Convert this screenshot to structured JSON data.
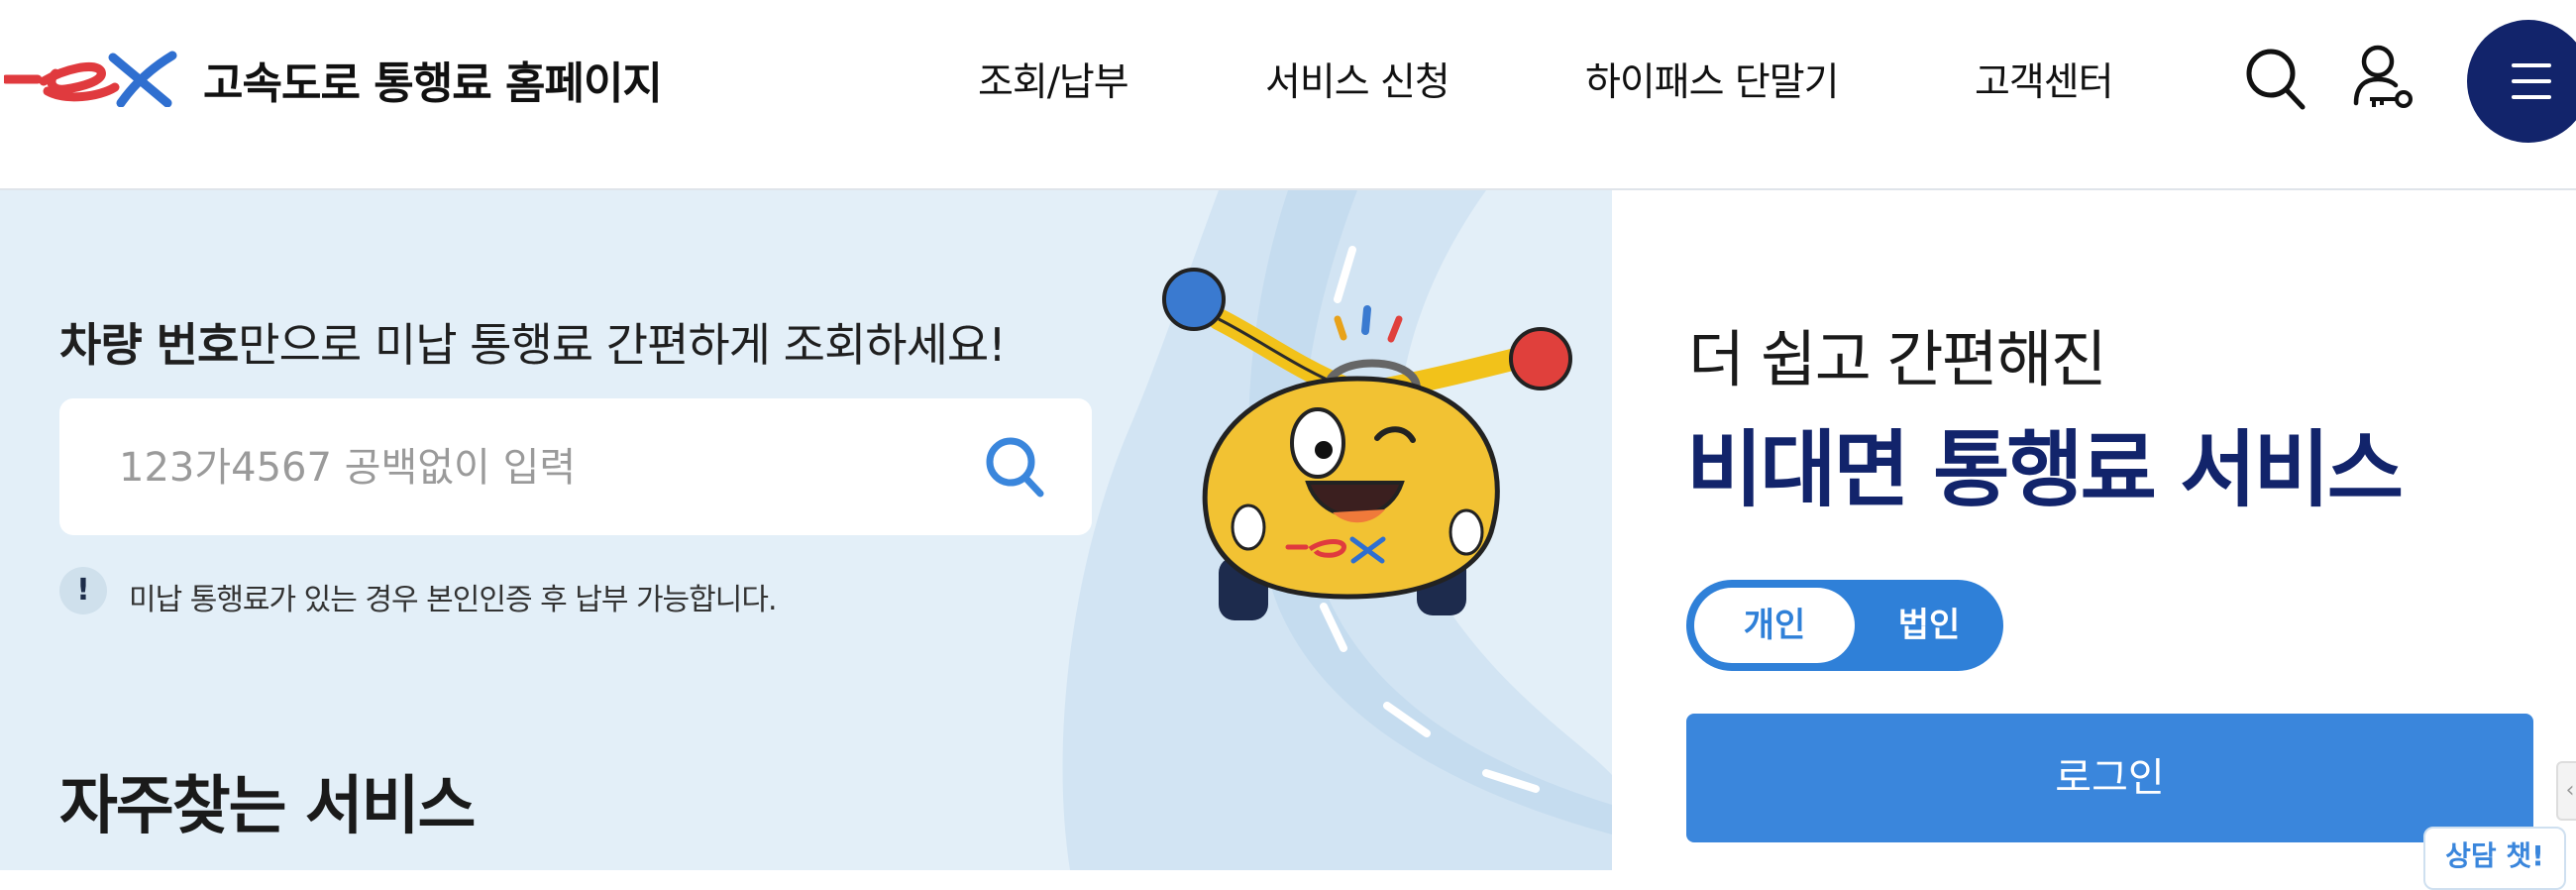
{
  "header": {
    "site_title": "고속도로 통행료 홈페이지",
    "nav": [
      "조회/납부",
      "서비스 신청",
      "하이패스 단말기",
      "고객센터"
    ],
    "icons": {
      "search": "search-icon",
      "user": "user-key-icon",
      "menu": "hamburger-menu-icon"
    }
  },
  "hero": {
    "title_bold": "차량 번호",
    "title_rest": "만으로 미납 통행료 간편하게 조회하세요!",
    "search_placeholder": "123가4567 공백없이 입력",
    "notice_mark": "!",
    "notice_text": "미납 통행료가 있는 경우 본인인증 후 납부 가능합니다.",
    "section_title": "자주찾는 서비스"
  },
  "side": {
    "subtitle": "더 쉽고 간편해진",
    "title": "비대면 통행료 서비스",
    "toggle_on": "개인",
    "toggle_off": "법인",
    "login_label": "로그인"
  },
  "chat_tab": "상담 챗!",
  "colors": {
    "navy": "#12246b",
    "blue": "#3a86dc",
    "hero_bg": "#e3eff8",
    "logo_red": "#e03a3e",
    "logo_blue": "#2f6fd0"
  }
}
